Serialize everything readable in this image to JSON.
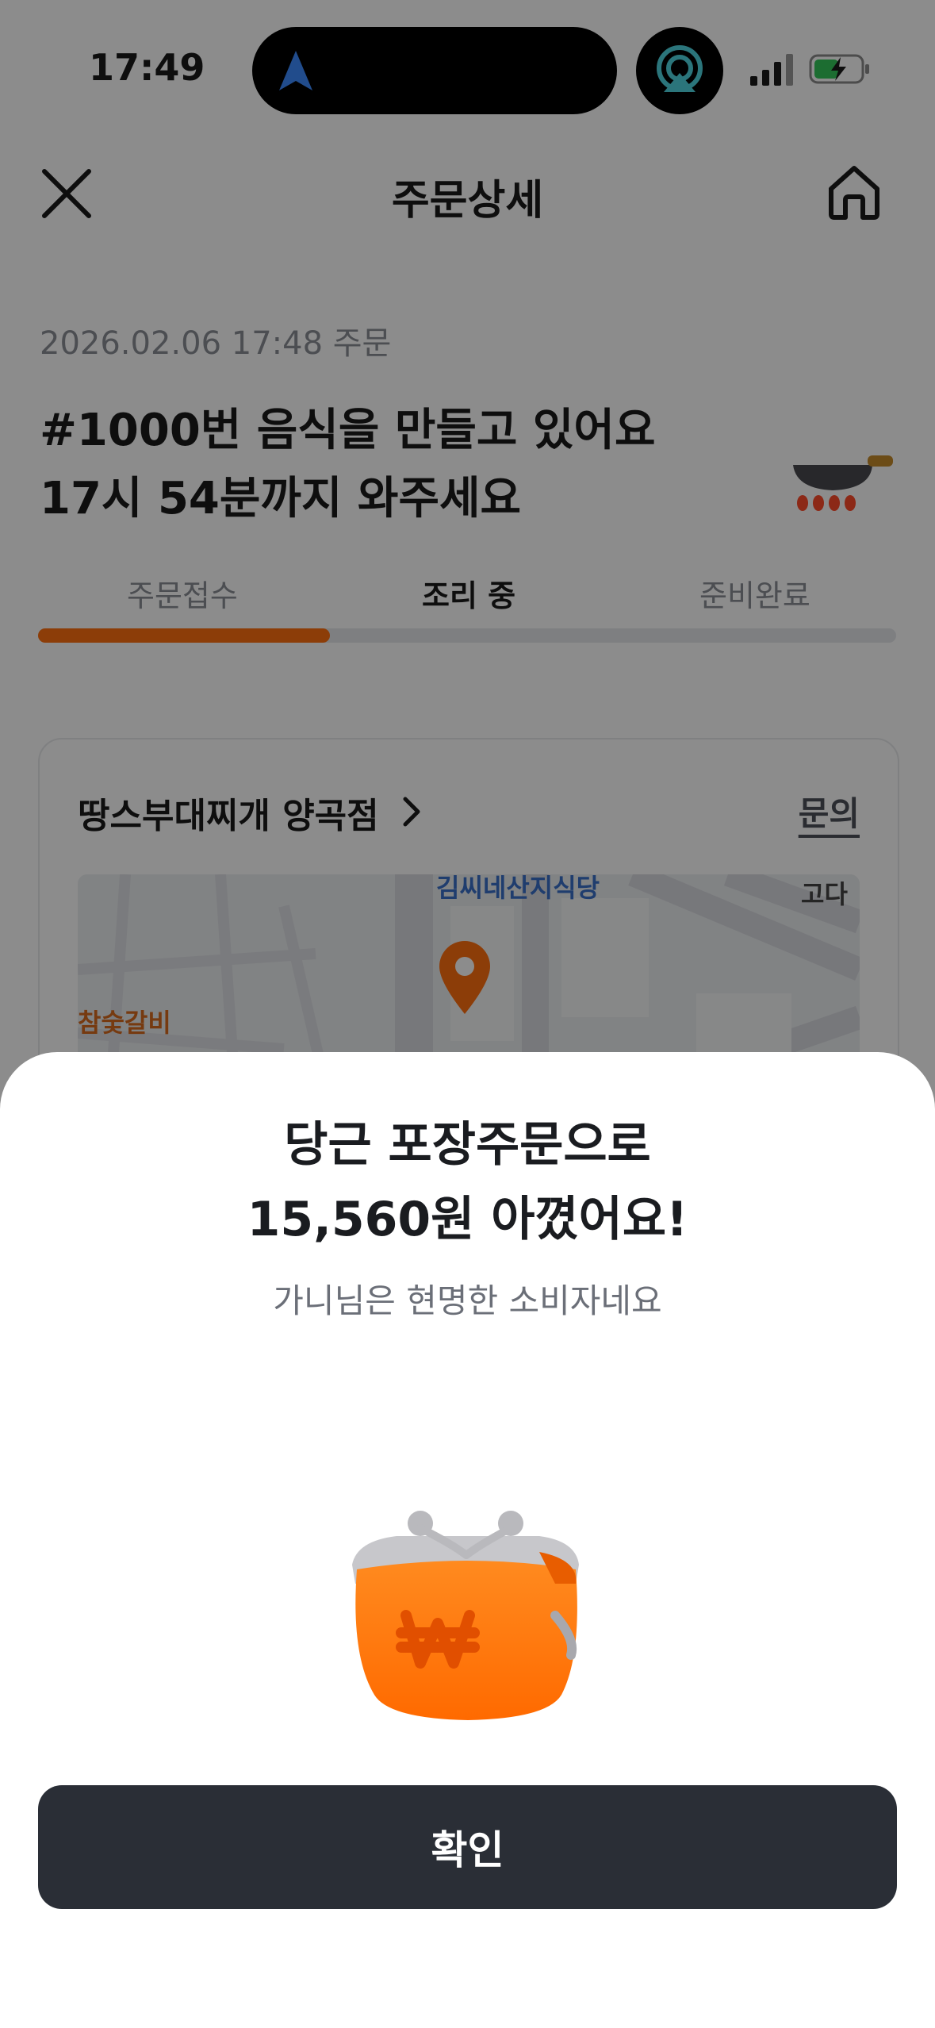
{
  "status_bar": {
    "time": "17:49",
    "icons": [
      "location-arrow-icon",
      "hotspot-icon",
      "signal-icon",
      "battery-charging-icon"
    ]
  },
  "header": {
    "title": "주문상세",
    "close_icon": "close-icon",
    "home_icon": "home-icon"
  },
  "order": {
    "date": "2026.02.06 17:48 주문",
    "headline_line1": "#1000번 음식을 만들고 있어요",
    "headline_line2": "17시 54분까지 와주세요",
    "status_icon": "wok-icon",
    "steps": [
      "주문접수",
      "조리 중",
      "준비완료"
    ],
    "active_step": 1,
    "progress_fraction": 0.34
  },
  "store": {
    "name": "땅스부대찌개 양곡점",
    "inquiry_label": "문의",
    "map_labels": [
      "김씨네산지식당",
      "고다",
      "참숯갈비"
    ]
  },
  "sheet": {
    "title_line1": "당근 포장주문으로",
    "title_line2": "15,560원 아꼈어요!",
    "subtitle": "가니님은 현명한 소비자네요",
    "image_icon": "wallet-icon",
    "confirm_label": "확인"
  },
  "colors": {
    "accent": "#ff6f0f",
    "button_dark": "#2a2e36",
    "text_primary": "#1a1c20",
    "text_secondary": "#8b8e95"
  }
}
